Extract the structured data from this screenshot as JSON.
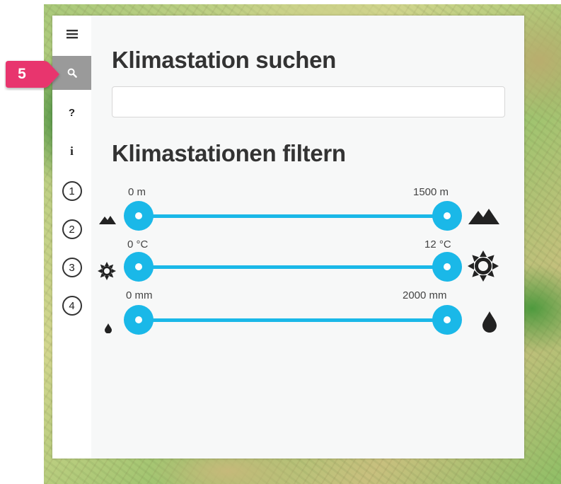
{
  "badge": {
    "label": "5",
    "color": "#e8356e"
  },
  "sidebar": {
    "items": [
      {
        "name": "menu-icon",
        "label": "≡"
      },
      {
        "name": "search-icon",
        "active": true
      },
      {
        "name": "help-icon",
        "label": "?"
      },
      {
        "name": "info-icon",
        "label": "i"
      },
      {
        "name": "step-1",
        "label": "1"
      },
      {
        "name": "step-2",
        "label": "2"
      },
      {
        "name": "step-3",
        "label": "3"
      },
      {
        "name": "step-4",
        "label": "4"
      }
    ]
  },
  "search": {
    "title": "Klimastation suchen",
    "value": "",
    "placeholder": ""
  },
  "filter": {
    "title": "Klimastationen filtern",
    "sliders": [
      {
        "name": "altitude",
        "icon": "mountain-icon",
        "min_label": "0 m",
        "max_label": "1500 m",
        "min": 0,
        "max": 1500,
        "unit": "m"
      },
      {
        "name": "temperature",
        "icon": "sun-icon",
        "min_label": "0 °C",
        "max_label": "12 °C",
        "min": 0,
        "max": 12,
        "unit": "°C"
      },
      {
        "name": "precipitation",
        "icon": "drop-icon",
        "min_label": "0 mm",
        "max_label": "2000 mm",
        "min": 0,
        "max": 2000,
        "unit": "mm"
      }
    ]
  },
  "colors": {
    "accent": "#1ab8e8",
    "badge": "#e8356e",
    "active_sidebar": "#9a9a9a",
    "title": "#333333"
  }
}
